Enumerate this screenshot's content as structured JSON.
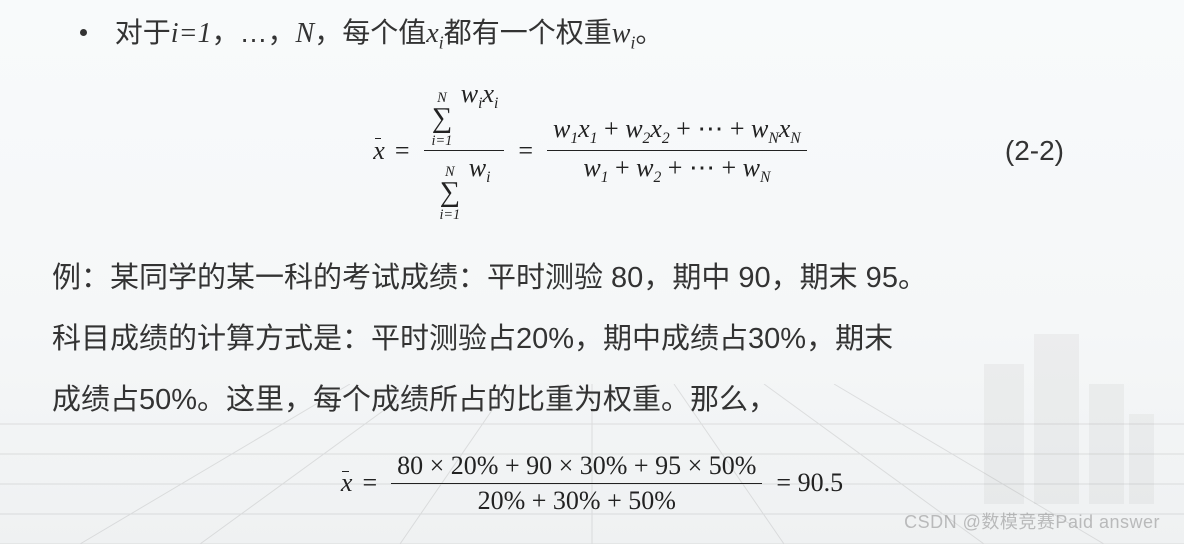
{
  "bullet": {
    "prefix": "对于",
    "i_eq": "i=1",
    "dots": "，…，",
    "N": "N",
    "mid": "，每个值",
    "x": "x",
    "x_sub": "i",
    "mid2": "都有一个权重",
    "w": "w",
    "w_sub": "i",
    "end": "。"
  },
  "formula1": {
    "lhs": "x̄",
    "eq": "=",
    "sum_top": "N",
    "sum_bot": "i=1",
    "num1_wx": "wᵢxᵢ",
    "den1_w": "wᵢ",
    "eq2": "=",
    "num2": "w₁x₁ + w₂x₂ + ⋯ + w_N x_N",
    "den2": "w₁ + w₂ + ⋯ + w_N",
    "label": "(2-2)"
  },
  "example": {
    "line1": "例：某同学的某一科的考试成绩：平时测验 80，期中 90，期末 95。",
    "line2": "科目成绩的计算方式是：平时测验占20%，期中成绩占30%，期末",
    "line3": "成绩占50%。这里，每个成绩所占的比重为权重。那么，"
  },
  "formula2": {
    "lhs": "x̄",
    "eq": "=",
    "num": "80 × 20% + 90 × 30% + 95 × 50%",
    "den": "20% + 30% + 50%",
    "eq2": "= 90.5"
  },
  "watermark": "CSDN @数模竞赛Paid answer"
}
